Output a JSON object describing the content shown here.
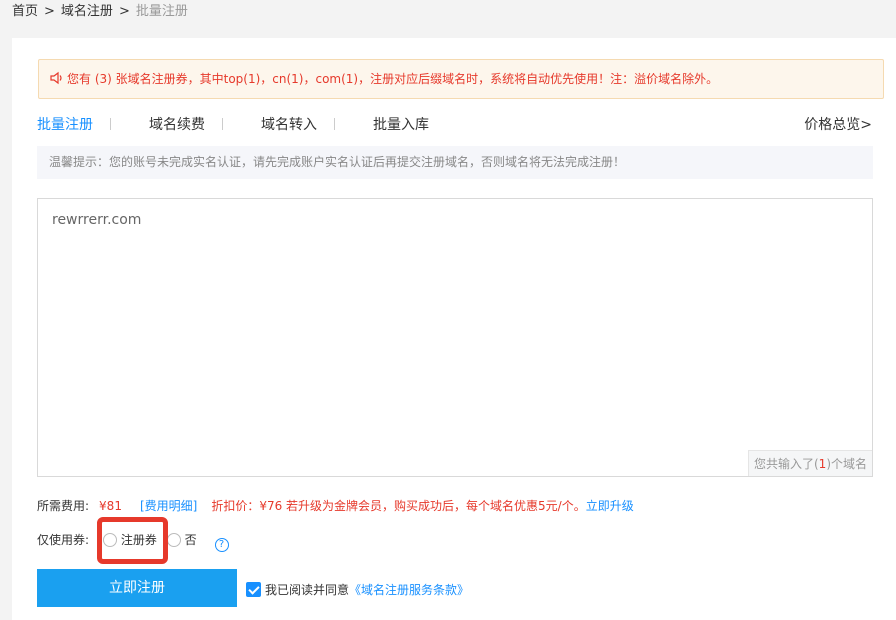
{
  "breadcrumb": {
    "home": "首页",
    "sep": ">",
    "level2": "域名注册",
    "current": "批量注册"
  },
  "notice": {
    "icon": "speaker-icon",
    "text": "您有 (3) 张域名注册券，其中top(1)，cn(1)，com(1)，注册对应后缀域名时，系统将自动优先使用！注：溢价域名除外。"
  },
  "tabs": [
    {
      "label": "批量注册",
      "active": true
    },
    {
      "label": "域名续费",
      "active": false
    },
    {
      "label": "域名转入",
      "active": false
    },
    {
      "label": "批量入库",
      "active": false
    }
  ],
  "price_link": "价格总览>",
  "tip": "温馨提示：您的账号未完成实名认证，请先完成账户实名认证后再提交注册域名，否则域名将无法完成注册！",
  "domain_input": {
    "value": "rewrrerr.com"
  },
  "count": {
    "prefix": "您共输入了(",
    "num": "1",
    "suffix": ")个域名"
  },
  "fee": {
    "label": "所需费用:",
    "price": "¥81",
    "detail": "[费用明细]",
    "discount": "折扣价：¥76 若升级为金牌会员，购买成功后，每个域名优惠5元/个。",
    "upgrade": "立即升级"
  },
  "coupon": {
    "label": "仅使用券:",
    "option1": "注册券",
    "option2": "否",
    "help": "?"
  },
  "submit": "立即注册",
  "agree": {
    "text": "我已阅读并同意",
    "terms": "《域名注册服务条款》"
  },
  "colors": {
    "accent": "#1890ff",
    "button": "#1aa0f0",
    "alert": "#e6392b"
  }
}
